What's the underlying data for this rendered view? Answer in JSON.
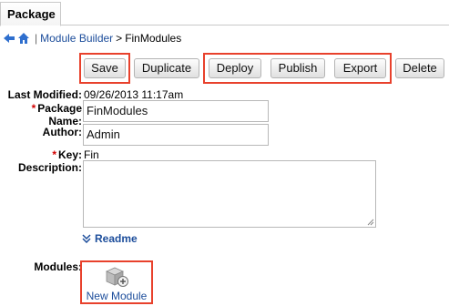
{
  "tabs": [
    {
      "label": "Package"
    }
  ],
  "breadcrumb": {
    "back_icon": "arrow-left-icon",
    "home_icon": "home-icon",
    "separator": "|",
    "link": "Module Builder",
    "arrow": ">",
    "current": "FinModules"
  },
  "toolbar": {
    "save_label": "Save",
    "duplicate_label": "Duplicate",
    "deploy_label": "Deploy",
    "publish_label": "Publish",
    "export_label": "Export",
    "delete_label": "Delete"
  },
  "form": {
    "last_modified_label": "Last Modified:",
    "last_modified_value": "09/26/2013 11:17am",
    "package_name_label": "Package Name:",
    "package_name_value": "FinModules",
    "author_label": "Author:",
    "author_value": "Admin",
    "key_label": "Key:",
    "key_value": "Fin",
    "description_label": "Description:",
    "required_mark": "*",
    "readme_link": "Readme",
    "modules_label": "Modules:",
    "new_module_label": "New Module"
  },
  "colors": {
    "highlight": "#e8412c",
    "link": "#1c4d9b",
    "required": "#d10000"
  }
}
